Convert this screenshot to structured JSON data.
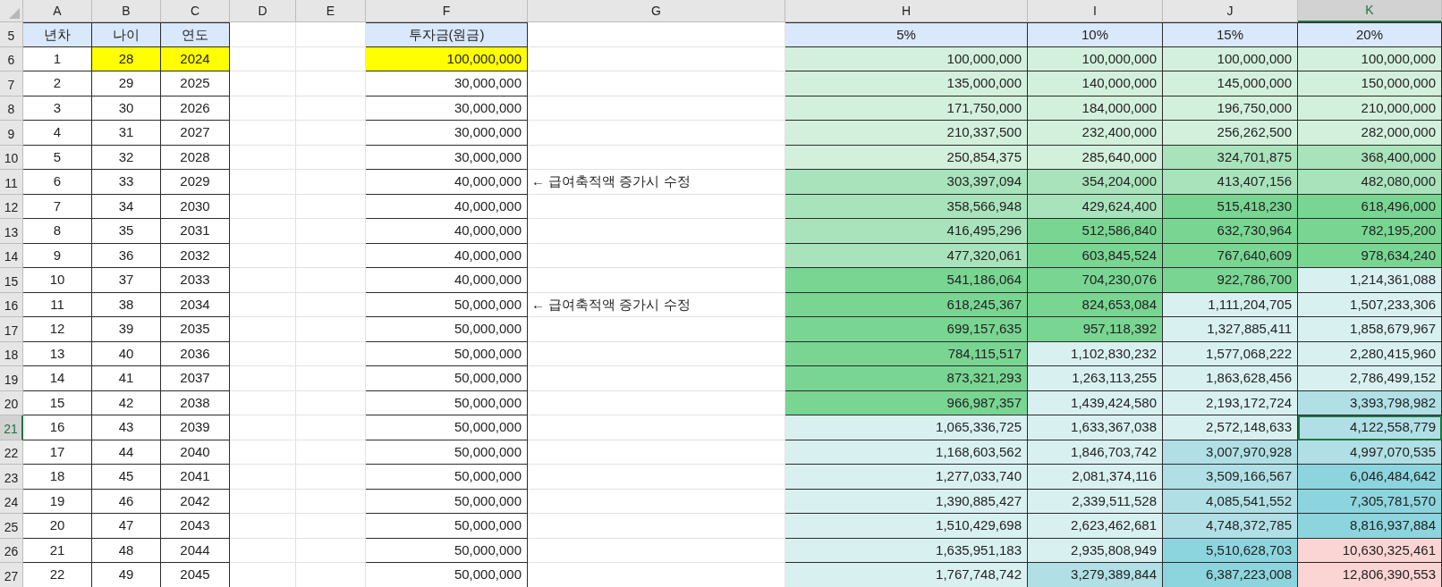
{
  "column_headers": [
    {
      "label": "A",
      "selected": false
    },
    {
      "label": "B",
      "selected": false
    },
    {
      "label": "C",
      "selected": false
    },
    {
      "label": "D",
      "selected": false
    },
    {
      "label": "E",
      "selected": false
    },
    {
      "label": "F",
      "selected": false
    },
    {
      "label": "G",
      "selected": false
    },
    {
      "label": "H",
      "selected": false
    },
    {
      "label": "I",
      "selected": false
    },
    {
      "label": "J",
      "selected": false
    },
    {
      "label": "K",
      "selected": true
    }
  ],
  "rows": [
    {
      "number": "5",
      "selected": false,
      "kind": "header",
      "year_index": {
        "text": "년차",
        "color": "#dae8fc"
      },
      "age": {
        "text": "나이",
        "color": "#dae8fc"
      },
      "year": {
        "text": "연도",
        "color": "#dae8fc"
      },
      "investment": {
        "text": "투자금(원금)",
        "color": "#dae8fc"
      },
      "returns": [
        {
          "text": "5%",
          "color": "#dae8fc"
        },
        {
          "text": "10%",
          "color": "#dae8fc"
        },
        {
          "text": "15%",
          "color": "#dae8fc"
        },
        {
          "text": "20%",
          "color": "#dae8fc"
        }
      ]
    },
    {
      "number": "6",
      "selected": false,
      "kind": "data",
      "year_index": {
        "text": "1"
      },
      "age": {
        "text": "28",
        "color": "#ffff00"
      },
      "year": {
        "text": "2024",
        "color": "#ffff00"
      },
      "investment": {
        "text": "100,000,000",
        "color": "#ffff00"
      },
      "returns": [
        {
          "text": "100,000,000",
          "color": "#d3f0dc"
        },
        {
          "text": "100,000,000",
          "color": "#d3f0dc"
        },
        {
          "text": "100,000,000",
          "color": "#d3f0dc"
        },
        {
          "text": "100,000,000",
          "color": "#d3f0dc"
        }
      ]
    },
    {
      "number": "7",
      "selected": false,
      "kind": "data",
      "year_index": {
        "text": "2"
      },
      "age": {
        "text": "29"
      },
      "year": {
        "text": "2025"
      },
      "investment": {
        "text": "30,000,000"
      },
      "returns": [
        {
          "text": "135,000,000",
          "color": "#d3f0dc"
        },
        {
          "text": "140,000,000",
          "color": "#d3f0dc"
        },
        {
          "text": "145,000,000",
          "color": "#d3f0dc"
        },
        {
          "text": "150,000,000",
          "color": "#d3f0dc"
        }
      ]
    },
    {
      "number": "8",
      "selected": false,
      "kind": "data",
      "year_index": {
        "text": "3"
      },
      "age": {
        "text": "30"
      },
      "year": {
        "text": "2026"
      },
      "investment": {
        "text": "30,000,000"
      },
      "returns": [
        {
          "text": "171,750,000",
          "color": "#d3f0dc"
        },
        {
          "text": "184,000,000",
          "color": "#d3f0dc"
        },
        {
          "text": "196,750,000",
          "color": "#d3f0dc"
        },
        {
          "text": "210,000,000",
          "color": "#d3f0dc"
        }
      ]
    },
    {
      "number": "9",
      "selected": false,
      "kind": "data",
      "year_index": {
        "text": "4"
      },
      "age": {
        "text": "31"
      },
      "year": {
        "text": "2027"
      },
      "investment": {
        "text": "30,000,000"
      },
      "returns": [
        {
          "text": "210,337,500",
          "color": "#d3f0dc"
        },
        {
          "text": "232,400,000",
          "color": "#d3f0dc"
        },
        {
          "text": "256,262,500",
          "color": "#d3f0dc"
        },
        {
          "text": "282,000,000",
          "color": "#d3f0dc"
        }
      ]
    },
    {
      "number": "10",
      "selected": false,
      "kind": "data",
      "year_index": {
        "text": "5"
      },
      "age": {
        "text": "32"
      },
      "year": {
        "text": "2028"
      },
      "investment": {
        "text": "30,000,000"
      },
      "returns": [
        {
          "text": "250,854,375",
          "color": "#d3f0dc"
        },
        {
          "text": "285,640,000",
          "color": "#d3f0dc"
        },
        {
          "text": "324,701,875",
          "color": "#a9e3bb"
        },
        {
          "text": "368,400,000",
          "color": "#a9e3bb"
        }
      ]
    },
    {
      "number": "11",
      "selected": false,
      "kind": "data",
      "year_index": {
        "text": "6"
      },
      "age": {
        "text": "33"
      },
      "year": {
        "text": "2029"
      },
      "investment": {
        "text": "40,000,000"
      },
      "note": "← 급여축적액 증가시 수정",
      "returns": [
        {
          "text": "303,397,094",
          "color": "#a9e3bb"
        },
        {
          "text": "354,204,000",
          "color": "#a9e3bb"
        },
        {
          "text": "413,407,156",
          "color": "#a9e3bb"
        },
        {
          "text": "482,080,000",
          "color": "#a9e3bb"
        }
      ]
    },
    {
      "number": "12",
      "selected": false,
      "kind": "data",
      "year_index": {
        "text": "7"
      },
      "age": {
        "text": "34"
      },
      "year": {
        "text": "2030"
      },
      "investment": {
        "text": "40,000,000"
      },
      "returns": [
        {
          "text": "358,566,948",
          "color": "#a9e3bb"
        },
        {
          "text": "429,624,400",
          "color": "#a9e3bb"
        },
        {
          "text": "515,418,230",
          "color": "#79d592"
        },
        {
          "text": "618,496,000",
          "color": "#79d592"
        }
      ]
    },
    {
      "number": "13",
      "selected": false,
      "kind": "data",
      "year_index": {
        "text": "8"
      },
      "age": {
        "text": "35"
      },
      "year": {
        "text": "2031"
      },
      "investment": {
        "text": "40,000,000"
      },
      "returns": [
        {
          "text": "416,495,296",
          "color": "#a9e3bb"
        },
        {
          "text": "512,586,840",
          "color": "#79d592"
        },
        {
          "text": "632,730,964",
          "color": "#79d592"
        },
        {
          "text": "782,195,200",
          "color": "#79d592"
        }
      ]
    },
    {
      "number": "14",
      "selected": false,
      "kind": "data",
      "year_index": {
        "text": "9"
      },
      "age": {
        "text": "36"
      },
      "year": {
        "text": "2032"
      },
      "investment": {
        "text": "40,000,000"
      },
      "returns": [
        {
          "text": "477,320,061",
          "color": "#a9e3bb"
        },
        {
          "text": "603,845,524",
          "color": "#79d592"
        },
        {
          "text": "767,640,609",
          "color": "#79d592"
        },
        {
          "text": "978,634,240",
          "color": "#79d592"
        }
      ]
    },
    {
      "number": "15",
      "selected": false,
      "kind": "data",
      "year_index": {
        "text": "10"
      },
      "age": {
        "text": "37"
      },
      "year": {
        "text": "2033"
      },
      "investment": {
        "text": "40,000,000"
      },
      "returns": [
        {
          "text": "541,186,064",
          "color": "#79d592"
        },
        {
          "text": "704,230,076",
          "color": "#79d592"
        },
        {
          "text": "922,786,700",
          "color": "#79d592"
        },
        {
          "text": "1,214,361,088",
          "color": "#d9f0f1"
        }
      ]
    },
    {
      "number": "16",
      "selected": false,
      "kind": "data",
      "year_index": {
        "text": "11"
      },
      "age": {
        "text": "38"
      },
      "year": {
        "text": "2034"
      },
      "investment": {
        "text": "50,000,000"
      },
      "note": "← 급여축적액 증가시 수정",
      "returns": [
        {
          "text": "618,245,367",
          "color": "#79d592"
        },
        {
          "text": "824,653,084",
          "color": "#79d592"
        },
        {
          "text": "1,111,204,705",
          "color": "#d9f0f1"
        },
        {
          "text": "1,507,233,306",
          "color": "#d9f0f1"
        }
      ]
    },
    {
      "number": "17",
      "selected": false,
      "kind": "data",
      "year_index": {
        "text": "12"
      },
      "age": {
        "text": "39"
      },
      "year": {
        "text": "2035"
      },
      "investment": {
        "text": "50,000,000"
      },
      "returns": [
        {
          "text": "699,157,635",
          "color": "#79d592"
        },
        {
          "text": "957,118,392",
          "color": "#79d592"
        },
        {
          "text": "1,327,885,411",
          "color": "#d9f0f1"
        },
        {
          "text": "1,858,679,967",
          "color": "#d9f0f1"
        }
      ]
    },
    {
      "number": "18",
      "selected": false,
      "kind": "data",
      "year_index": {
        "text": "13"
      },
      "age": {
        "text": "40"
      },
      "year": {
        "text": "2036"
      },
      "investment": {
        "text": "50,000,000"
      },
      "returns": [
        {
          "text": "784,115,517",
          "color": "#79d592"
        },
        {
          "text": "1,102,830,232",
          "color": "#d9f0f1"
        },
        {
          "text": "1,577,068,222",
          "color": "#d9f0f1"
        },
        {
          "text": "2,280,415,960",
          "color": "#d9f0f1"
        }
      ]
    },
    {
      "number": "19",
      "selected": false,
      "kind": "data",
      "year_index": {
        "text": "14"
      },
      "age": {
        "text": "41"
      },
      "year": {
        "text": "2037"
      },
      "investment": {
        "text": "50,000,000"
      },
      "returns": [
        {
          "text": "873,321,293",
          "color": "#79d592"
        },
        {
          "text": "1,263,113,255",
          "color": "#d9f0f1"
        },
        {
          "text": "1,863,628,456",
          "color": "#d9f0f1"
        },
        {
          "text": "2,786,499,152",
          "color": "#d9f0f1"
        }
      ]
    },
    {
      "number": "20",
      "selected": false,
      "kind": "data",
      "year_index": {
        "text": "15"
      },
      "age": {
        "text": "42"
      },
      "year": {
        "text": "2038"
      },
      "investment": {
        "text": "50,000,000"
      },
      "returns": [
        {
          "text": "966,987,357",
          "color": "#79d592"
        },
        {
          "text": "1,439,424,580",
          "color": "#d9f0f1"
        },
        {
          "text": "2,193,172,724",
          "color": "#d9f0f1"
        },
        {
          "text": "3,393,798,982",
          "color": "#b0e0e6"
        }
      ]
    },
    {
      "number": "21",
      "selected": true,
      "kind": "data",
      "year_index": {
        "text": "16"
      },
      "age": {
        "text": "43"
      },
      "year": {
        "text": "2039"
      },
      "investment": {
        "text": "50,000,000"
      },
      "returns": [
        {
          "text": "1,065,336,725",
          "color": "#d9f0f1"
        },
        {
          "text": "1,633,367,038",
          "color": "#d9f0f1"
        },
        {
          "text": "2,572,148,633",
          "color": "#d9f0f1"
        },
        {
          "text": "4,122,558,779",
          "color": "#b0e0e6"
        }
      ]
    },
    {
      "number": "22",
      "selected": false,
      "kind": "data",
      "year_index": {
        "text": "17"
      },
      "age": {
        "text": "44"
      },
      "year": {
        "text": "2040"
      },
      "investment": {
        "text": "50,000,000"
      },
      "returns": [
        {
          "text": "1,168,603,562",
          "color": "#d9f0f1"
        },
        {
          "text": "1,846,703,742",
          "color": "#d9f0f1"
        },
        {
          "text": "3,007,970,928",
          "color": "#b0e0e6"
        },
        {
          "text": "4,997,070,535",
          "color": "#b0e0e6"
        }
      ]
    },
    {
      "number": "23",
      "selected": false,
      "kind": "data",
      "year_index": {
        "text": "18"
      },
      "age": {
        "text": "45"
      },
      "year": {
        "text": "2041"
      },
      "investment": {
        "text": "50,000,000"
      },
      "returns": [
        {
          "text": "1,277,033,740",
          "color": "#d9f0f1"
        },
        {
          "text": "2,081,374,116",
          "color": "#d9f0f1"
        },
        {
          "text": "3,509,166,567",
          "color": "#b0e0e6"
        },
        {
          "text": "6,046,484,642",
          "color": "#8dd5de"
        }
      ]
    },
    {
      "number": "24",
      "selected": false,
      "kind": "data",
      "year_index": {
        "text": "19"
      },
      "age": {
        "text": "46"
      },
      "year": {
        "text": "2042"
      },
      "investment": {
        "text": "50,000,000"
      },
      "returns": [
        {
          "text": "1,390,885,427",
          "color": "#d9f0f1"
        },
        {
          "text": "2,339,511,528",
          "color": "#d9f0f1"
        },
        {
          "text": "4,085,541,552",
          "color": "#b0e0e6"
        },
        {
          "text": "7,305,781,570",
          "color": "#8dd5de"
        }
      ]
    },
    {
      "number": "25",
      "selected": false,
      "kind": "data",
      "year_index": {
        "text": "20"
      },
      "age": {
        "text": "47"
      },
      "year": {
        "text": "2043"
      },
      "investment": {
        "text": "50,000,000"
      },
      "returns": [
        {
          "text": "1,510,429,698",
          "color": "#d9f0f1"
        },
        {
          "text": "2,623,462,681",
          "color": "#d9f0f1"
        },
        {
          "text": "4,748,372,785",
          "color": "#b0e0e6"
        },
        {
          "text": "8,816,937,884",
          "color": "#8dd5de"
        }
      ]
    },
    {
      "number": "26",
      "selected": false,
      "kind": "data",
      "year_index": {
        "text": "21"
      },
      "age": {
        "text": "48"
      },
      "year": {
        "text": "2044"
      },
      "investment": {
        "text": "50,000,000"
      },
      "returns": [
        {
          "text": "1,635,951,183",
          "color": "#d9f0f1"
        },
        {
          "text": "2,935,808,949",
          "color": "#d9f0f1"
        },
        {
          "text": "5,510,628,703",
          "color": "#8dd5de"
        },
        {
          "text": "10,630,325,461",
          "color": "#fbd5d3"
        }
      ]
    },
    {
      "number": "27",
      "selected": false,
      "kind": "data",
      "year_index": {
        "text": "22"
      },
      "age": {
        "text": "49"
      },
      "year": {
        "text": "2045"
      },
      "investment": {
        "text": "50,000,000"
      },
      "returns": [
        {
          "text": "1,767,748,742",
          "color": "#d9f0f1"
        },
        {
          "text": "3,279,389,844",
          "color": "#b0e0e6"
        },
        {
          "text": "6,387,223,008",
          "color": "#8dd5de"
        },
        {
          "text": "12,806,390,553",
          "color": "#fbd5d3"
        }
      ]
    }
  ]
}
